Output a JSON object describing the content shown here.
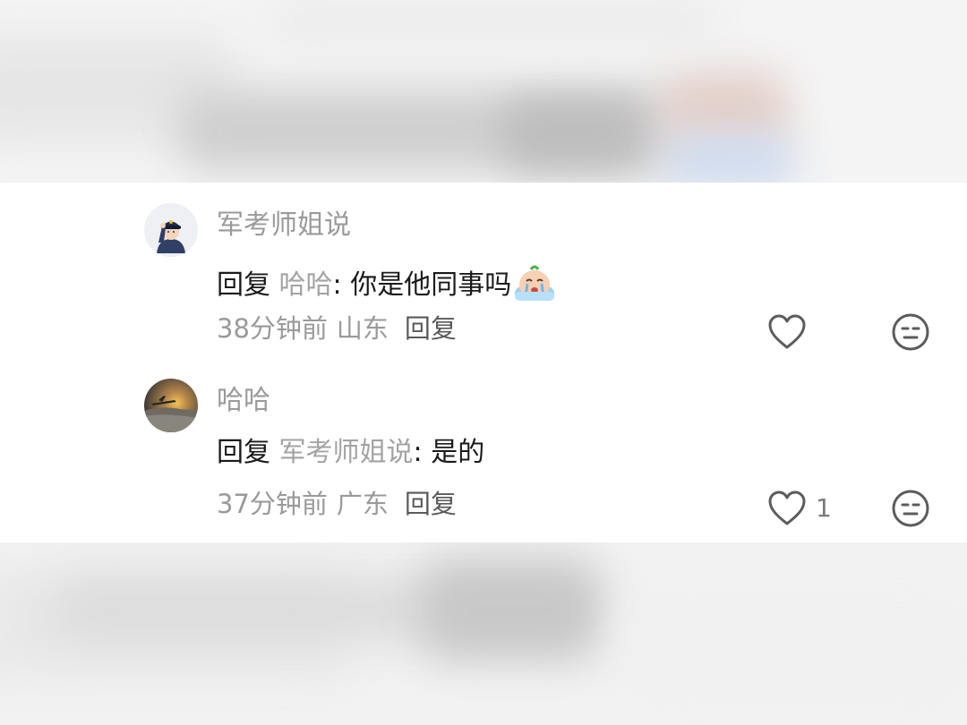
{
  "comments": [
    {
      "username": "军考师姐说",
      "reply_prefix": "回复",
      "reply_target": "哈哈",
      "reply_text": "你是他同事吗",
      "emoji_icon": "crying-face-emoji",
      "time": "38分钟前",
      "location": "山东",
      "reply_label": "回复",
      "avatar_icon": "soldier-saluting-avatar",
      "like_count": ""
    },
    {
      "username": "哈哈",
      "reply_prefix": "回复",
      "reply_target": "军考师姐说",
      "reply_text": "是的",
      "time": "37分钟前",
      "location": "广东",
      "reply_label": "回复",
      "avatar_icon": "sunset-plane-avatar",
      "like_count": "1"
    }
  ],
  "icons": {
    "like": "heart-outline-icon",
    "dislike": "neutral-face-icon"
  },
  "colors": {
    "username": "#9a9a9a",
    "text": "#1a1a1a",
    "icon_stroke": "#5c5c5c"
  }
}
